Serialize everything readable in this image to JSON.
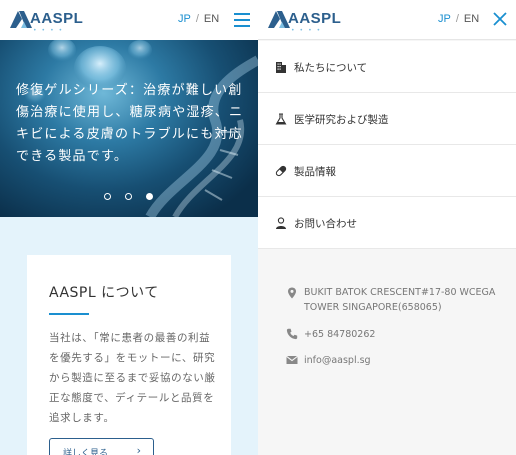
{
  "left_header": {
    "logo_text": "AASPL",
    "lang_jp": "JP",
    "lang_sep": "/",
    "lang_en": "EN"
  },
  "hero": {
    "text": "修復ゲルシリーズ：治療が難しい創傷治療に使用し、糖尿病や湿疹、ニキビによる皮膚のトラブルにも対応できる製品です。",
    "slide_count": 3,
    "active_slide": 3
  },
  "about_card": {
    "title": "AASPL について",
    "body": "当社は、「常に患者の最善の利益を優先する」をモットーに、研究から製造に至るまで妥協のない厳正な態度で、ディテールと品質を追求します。",
    "more_label": "詳しく見る",
    "more_arrow": "›"
  },
  "right_header": {
    "logo_text": "AASPL",
    "lang_jp": "JP",
    "lang_sep": "/",
    "lang_en": "EN"
  },
  "nav": {
    "items": [
      {
        "label": "私たちについて",
        "icon": "building-icon"
      },
      {
        "label": "医学研究および製造",
        "icon": "flask-icon"
      },
      {
        "label": "製品情報",
        "icon": "capsule-icon"
      },
      {
        "label": "お問い合わせ",
        "icon": "person-icon"
      }
    ]
  },
  "contact": {
    "address": "BUKIT BATOK CRESCENT#17-80 WCEGA TOWER SINGAPORE(658065)",
    "phone": "+65 84780262",
    "email": "info@aaspl.sg"
  },
  "colors": {
    "accent": "#1a8fd0",
    "brand": "#2c5f8d",
    "light_bg": "#e4f3fb"
  }
}
